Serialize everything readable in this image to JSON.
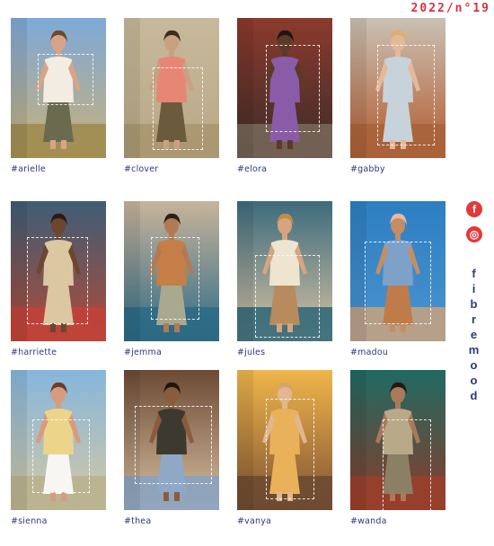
{
  "issue": "2022/n°19",
  "brand": "fibremood",
  "social": [
    {
      "name": "facebook-icon",
      "glyph": "f"
    },
    {
      "name": "instagram-icon",
      "glyph": "◎"
    }
  ],
  "colors": {
    "accent": "#d6323a",
    "navy": "#2b3a7c"
  },
  "patterns": [
    {
      "tag": "#arielle"
    },
    {
      "tag": "#clover"
    },
    {
      "tag": "#elora"
    },
    {
      "tag": "#gabby"
    },
    {
      "tag": "#harriette"
    },
    {
      "tag": "#jemma"
    },
    {
      "tag": "#jules"
    },
    {
      "tag": "#madou"
    },
    {
      "tag": "#sienna"
    },
    {
      "tag": "#thea"
    },
    {
      "tag": "#vanya"
    },
    {
      "tag": "#wanda"
    }
  ]
}
